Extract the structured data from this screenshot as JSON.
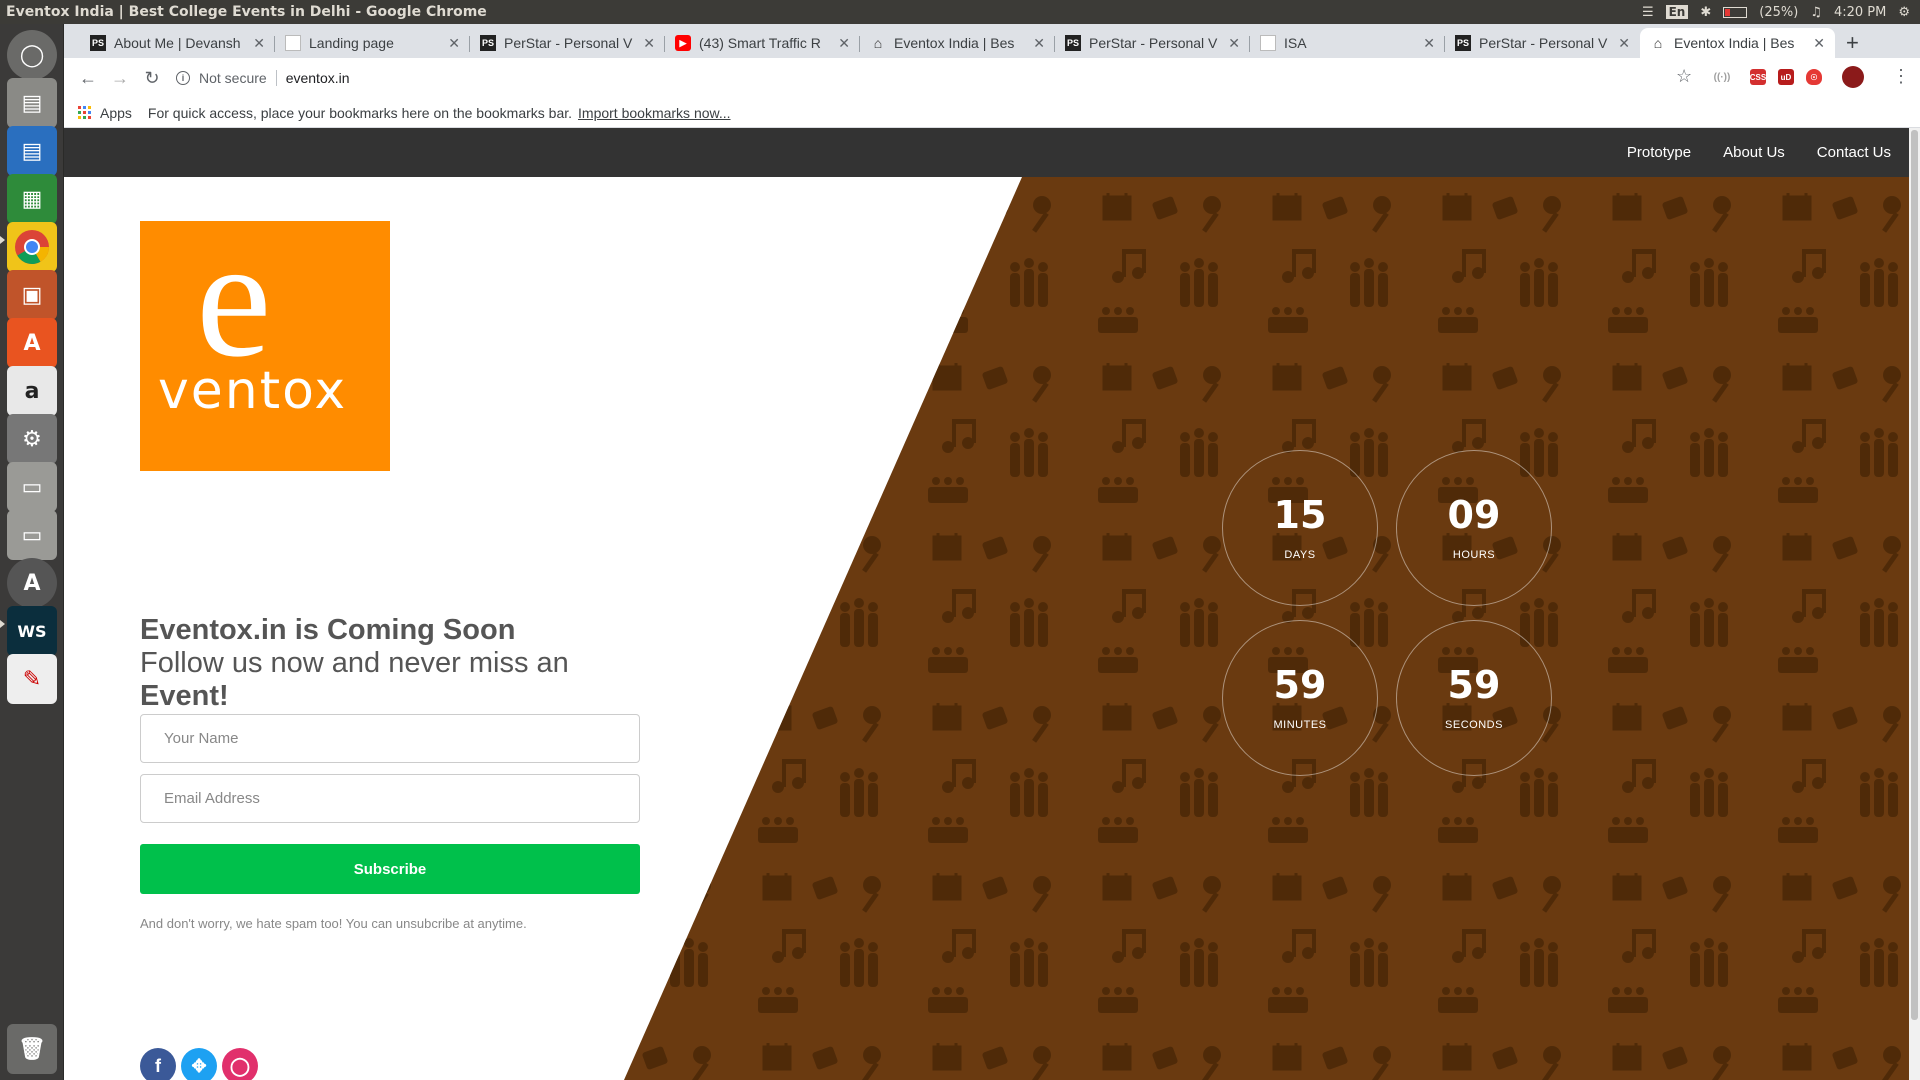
{
  "os": {
    "window_title": "Eventox India | Best College Events in Delhi - Google Chrome",
    "tray": {
      "lang": "En",
      "battery": "(25%)",
      "time": "4:20 PM"
    },
    "launcher": [
      "ubuntu-dash",
      "files",
      "writer",
      "calc",
      "chrome",
      "impress",
      "software-center",
      "amazon",
      "system-settings",
      "drive-1",
      "drive-2",
      "software-updater",
      "webstorm",
      "text-editor",
      "trash"
    ]
  },
  "browser": {
    "tabs": [
      {
        "label": "About Me | Devansh",
        "fav": "PS"
      },
      {
        "label": "Landing page",
        "fav": ""
      },
      {
        "label": "PerStar - Personal V",
        "fav": "PS"
      },
      {
        "label": "(43) Smart Traffic R",
        "fav": "yt"
      },
      {
        "label": "Eventox India | Bes",
        "fav": "home"
      },
      {
        "label": "PerStar - Personal V",
        "fav": "PS"
      },
      {
        "label": "ISA",
        "fav": ""
      },
      {
        "label": "PerStar - Personal V",
        "fav": "PS"
      },
      {
        "label": "Eventox India | Bes",
        "fav": "home"
      }
    ],
    "address": {
      "security": "Not secure",
      "url": "eventox.in"
    },
    "bookmarks": {
      "apps": "Apps",
      "hint": "For quick access, place your bookmarks here on the bookmarks bar.",
      "import": "Import bookmarks now..."
    },
    "extensions": [
      {
        "icon": "rss-icon",
        "color": "#9e9e9e"
      },
      {
        "icon": "red-badge-icon",
        "color": "#d32f2f"
      },
      {
        "icon": "ublock-icon",
        "color": "#b71c1c"
      },
      {
        "icon": "shield-icon",
        "color": "#e53935"
      }
    ]
  },
  "site": {
    "nav": [
      "Prototype",
      "About Us",
      "Contact Us"
    ],
    "logo": {
      "letter": "e",
      "word": "ventox"
    },
    "headline": {
      "line1": "Eventox.in is Coming Soon",
      "line2": "Follow us now and never miss an",
      "line3": "Event!"
    },
    "form": {
      "name_placeholder": "Your Name",
      "email_placeholder": "Email Address",
      "subscribe": "Subscribe",
      "note": "And don't worry, we hate spam too! You can unsubcribe at anytime."
    },
    "social": [
      "facebook",
      "twitter",
      "instagram"
    ],
    "countdown": [
      {
        "value": "15",
        "unit": "DAYS"
      },
      {
        "value": "09",
        "unit": "HOURS"
      },
      {
        "value": "59",
        "unit": "MINUTES"
      },
      {
        "value": "59",
        "unit": "SECONDS"
      }
    ],
    "colors": {
      "brand_orange": "#ff8c00",
      "brown": "#6a3a10",
      "subscribe_green": "#00c04b",
      "nav_bg": "#333333"
    }
  }
}
